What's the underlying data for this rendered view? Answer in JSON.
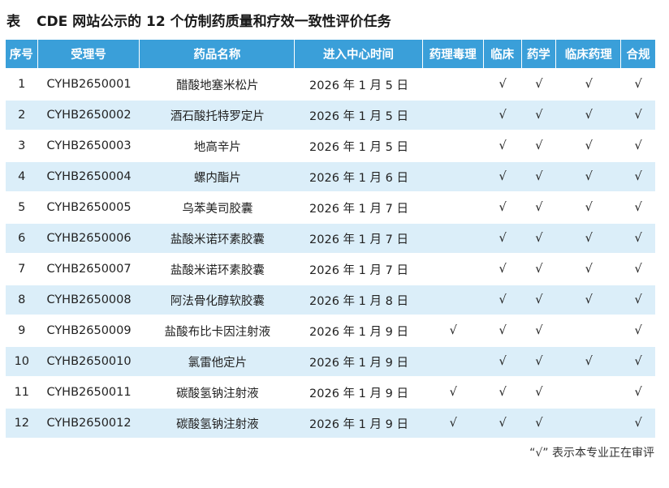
{
  "caption": {
    "label": "表",
    "text": "CDE 网站公示的 12 个仿制药质量和疗效一致性评价任务"
  },
  "table": {
    "headers": {
      "seq": "序号",
      "accept_no": "受理号",
      "drug_name": "药品名称",
      "entry_time": "进入中心时间",
      "pharm_tox": "药理毒理",
      "clinical": "临床",
      "pharmacy": "药学",
      "clin_pharm": "临床药理",
      "compliance": "合规"
    },
    "rows": [
      {
        "seq": "1",
        "accept_no": "CYHB2650001",
        "drug_name": "醋酸地塞米松片",
        "entry_time": "2026 年 1 月 5 日",
        "pharm_tox": "",
        "clinical": "√",
        "pharmacy": "√",
        "clin_pharm": "√",
        "compliance": "√"
      },
      {
        "seq": "2",
        "accept_no": "CYHB2650002",
        "drug_name": "酒石酸托特罗定片",
        "entry_time": "2026 年 1 月 5 日",
        "pharm_tox": "",
        "clinical": "√",
        "pharmacy": "√",
        "clin_pharm": "√",
        "compliance": "√"
      },
      {
        "seq": "3",
        "accept_no": "CYHB2650003",
        "drug_name": "地高辛片",
        "entry_time": "2026 年 1 月 5 日",
        "pharm_tox": "",
        "clinical": "√",
        "pharmacy": "√",
        "clin_pharm": "√",
        "compliance": "√"
      },
      {
        "seq": "4",
        "accept_no": "CYHB2650004",
        "drug_name": "螺内酯片",
        "entry_time": "2026 年 1 月 6 日",
        "pharm_tox": "",
        "clinical": "√",
        "pharmacy": "√",
        "clin_pharm": "√",
        "compliance": "√"
      },
      {
        "seq": "5",
        "accept_no": "CYHB2650005",
        "drug_name": "乌苯美司胶囊",
        "entry_time": "2026 年 1 月 7 日",
        "pharm_tox": "",
        "clinical": "√",
        "pharmacy": "√",
        "clin_pharm": "√",
        "compliance": "√"
      },
      {
        "seq": "6",
        "accept_no": "CYHB2650006",
        "drug_name": "盐酸米诺环素胶囊",
        "entry_time": "2026 年 1 月 7 日",
        "pharm_tox": "",
        "clinical": "√",
        "pharmacy": "√",
        "clin_pharm": "√",
        "compliance": "√"
      },
      {
        "seq": "7",
        "accept_no": "CYHB2650007",
        "drug_name": "盐酸米诺环素胶囊",
        "entry_time": "2026 年 1 月 7 日",
        "pharm_tox": "",
        "clinical": "√",
        "pharmacy": "√",
        "clin_pharm": "√",
        "compliance": "√"
      },
      {
        "seq": "8",
        "accept_no": "CYHB2650008",
        "drug_name": "阿法骨化醇软胶囊",
        "entry_time": "2026 年 1 月 8 日",
        "pharm_tox": "",
        "clinical": "√",
        "pharmacy": "√",
        "clin_pharm": "√",
        "compliance": "√"
      },
      {
        "seq": "9",
        "accept_no": "CYHB2650009",
        "drug_name": "盐酸布比卡因注射液",
        "entry_time": "2026 年 1 月 9 日",
        "pharm_tox": "√",
        "clinical": "√",
        "pharmacy": "√",
        "clin_pharm": "",
        "compliance": "√"
      },
      {
        "seq": "10",
        "accept_no": "CYHB2650010",
        "drug_name": "氯雷他定片",
        "entry_time": "2026 年 1 月 9 日",
        "pharm_tox": "",
        "clinical": "√",
        "pharmacy": "√",
        "clin_pharm": "√",
        "compliance": "√"
      },
      {
        "seq": "11",
        "accept_no": "CYHB2650011",
        "drug_name": "碳酸氢钠注射液",
        "entry_time": "2026 年 1 月 9 日",
        "pharm_tox": "√",
        "clinical": "√",
        "pharmacy": "√",
        "clin_pharm": "",
        "compliance": "√"
      },
      {
        "seq": "12",
        "accept_no": "CYHB2650012",
        "drug_name": "碳酸氢钠注射液",
        "entry_time": "2026 年 1 月 9 日",
        "pharm_tox": "√",
        "clinical": "√",
        "pharmacy": "√",
        "clin_pharm": "",
        "compliance": "√"
      }
    ]
  },
  "footnote": "“√” 表示本专业正在审评",
  "colors": {
    "header_bg": "#3a9fd9",
    "stripe_bg": "#dbeef9"
  }
}
